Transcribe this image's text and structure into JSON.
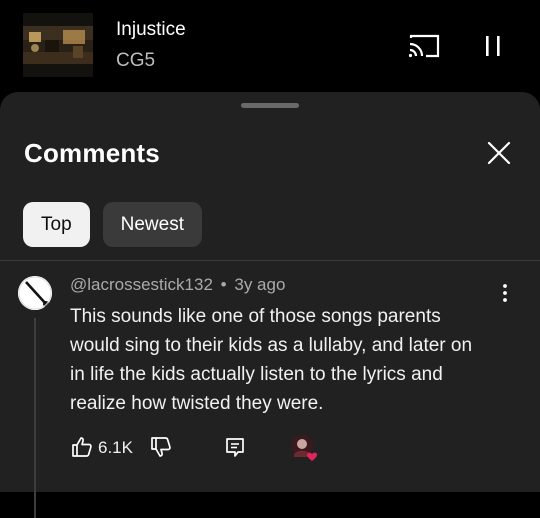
{
  "player": {
    "title": "Injustice",
    "artist": "CG5",
    "cast_icon": "cast-icon",
    "pause_icon": "pause-icon"
  },
  "comments_panel": {
    "title": "Comments",
    "close_icon": "close-icon",
    "tabs": [
      {
        "label": "Top",
        "selected": true
      },
      {
        "label": "Newest",
        "selected": false
      }
    ]
  },
  "comment": {
    "author": "@lacrossestick132",
    "separator": "•",
    "age": "3y ago",
    "text": "This sounds like one of those songs parents would sing to their kids as a lullaby, and later on in life the kids actually listen to the lyrics and realize how twisted they were.",
    "likes": "6.1K",
    "has_creator_heart": true
  },
  "colors": {
    "sheet_bg": "#212121",
    "chip_active_bg": "#f1f1f1",
    "chip_bg": "#3a3a3a",
    "heart": "#e0245e"
  }
}
